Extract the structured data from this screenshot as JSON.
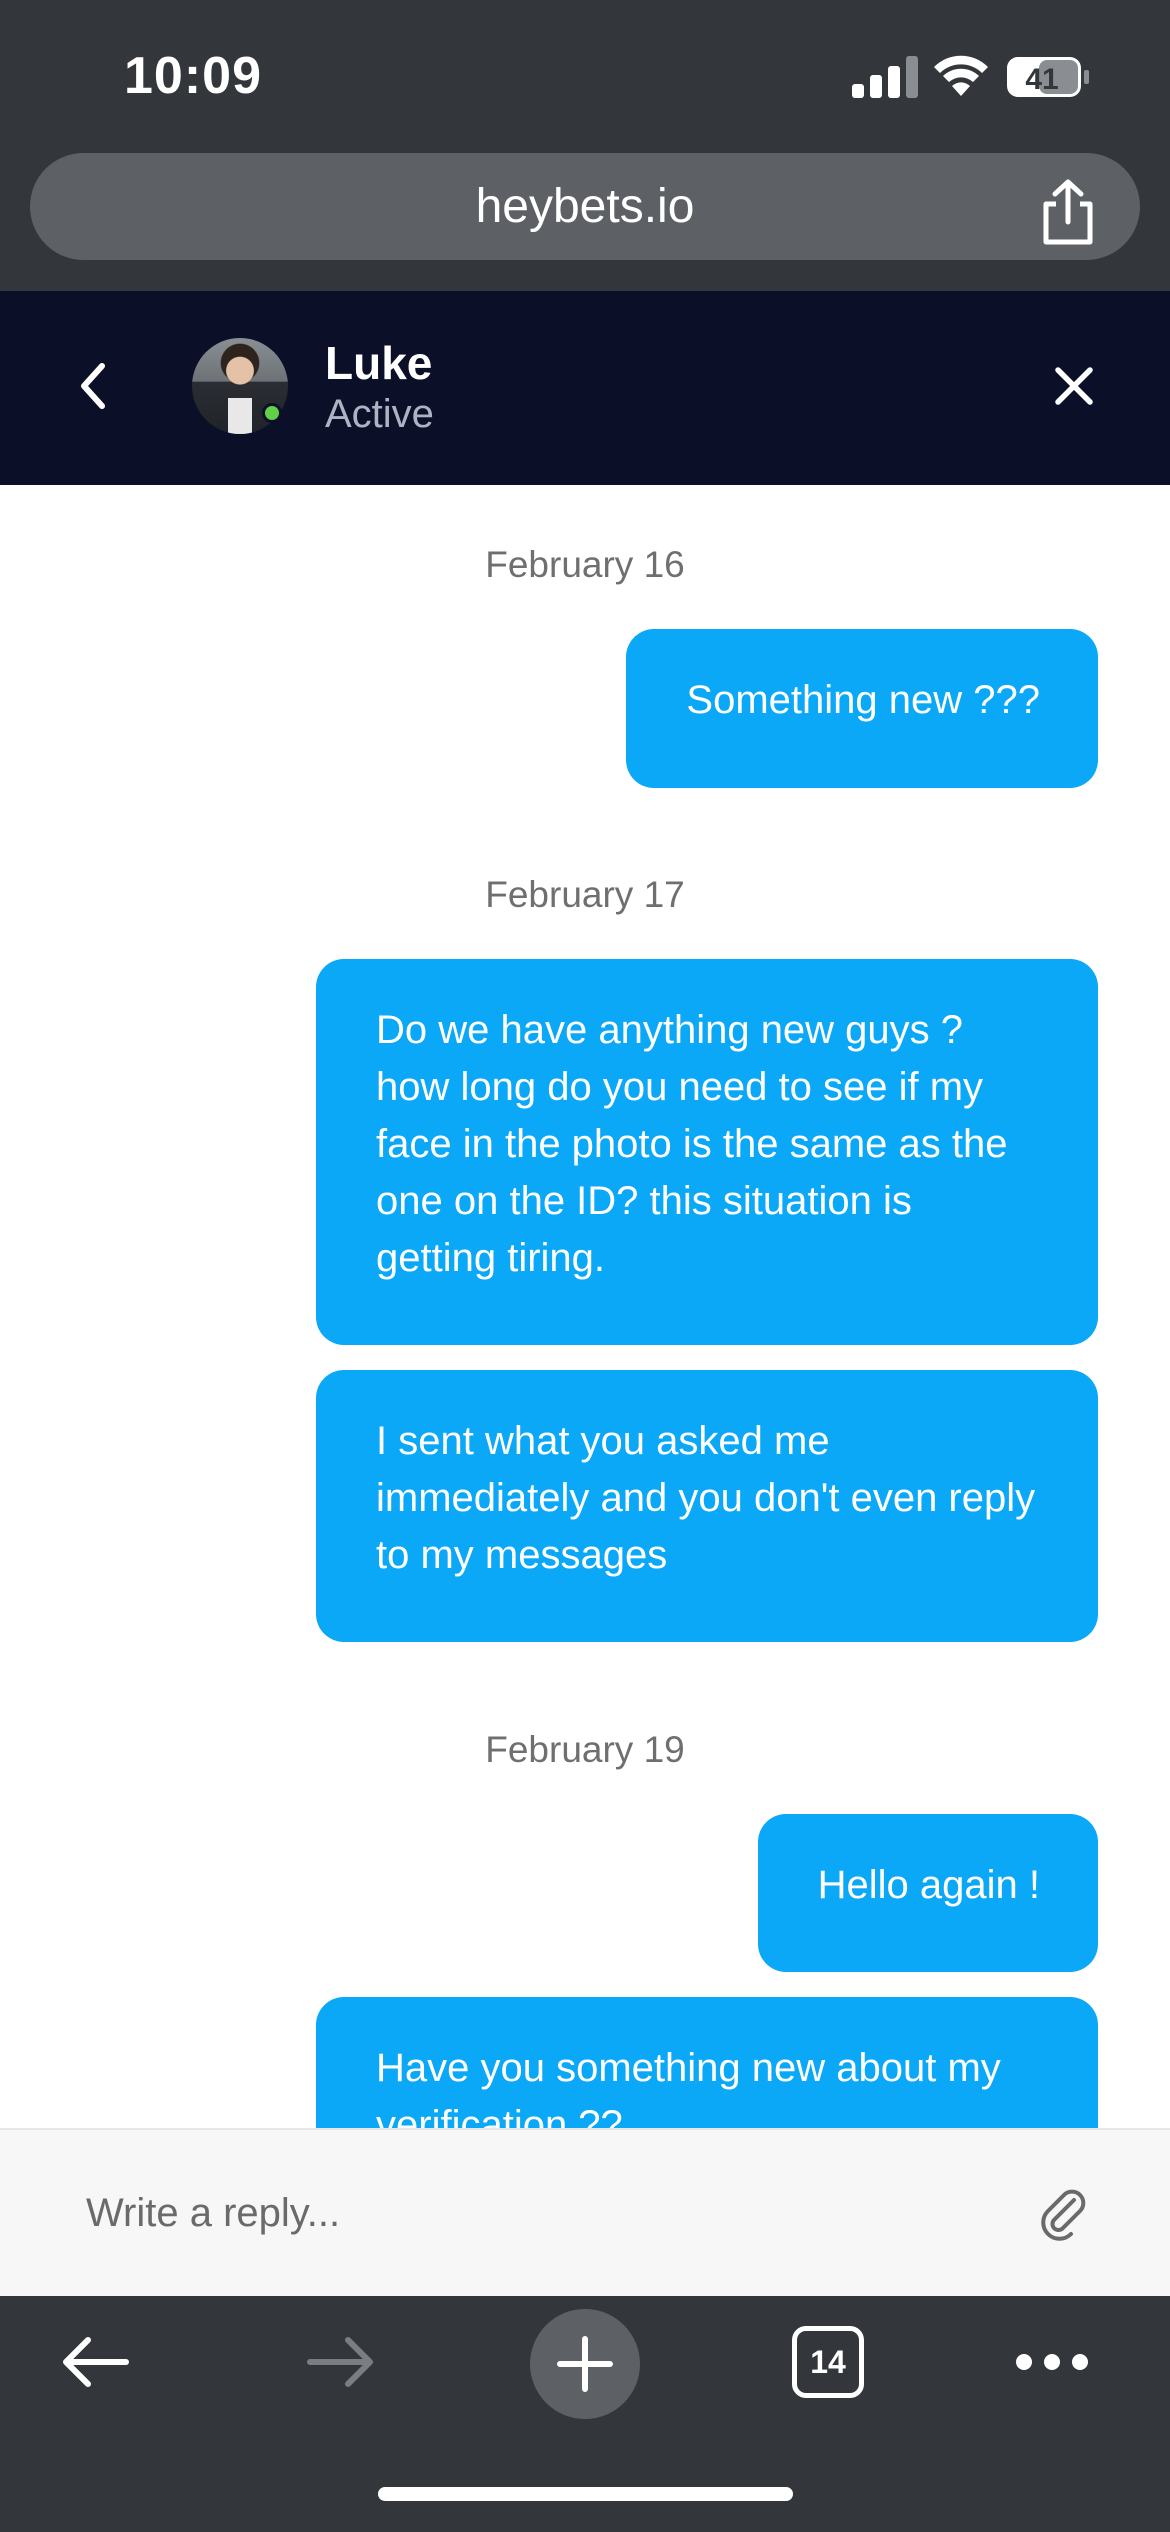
{
  "status_bar": {
    "time": "10:09",
    "battery": "41"
  },
  "browser": {
    "url": "heybets.io",
    "tab_count": "14"
  },
  "chat_header": {
    "name": "Luke",
    "status": "Active"
  },
  "messages": [
    {
      "date": "February 16"
    },
    {
      "text": "Something new ???"
    },
    {
      "date": "February 17"
    },
    {
      "text": "Do we have anything new guys ? how long do you need to see if my face in the photo is the same as the one on the ID? this situation is getting tiring."
    },
    {
      "text": "I sent what you asked me immediately and you don't even reply to my messages"
    },
    {
      "date": "February 19"
    },
    {
      "text": "Hello again !"
    },
    {
      "text": "Have you something new about my verification ??"
    }
  ],
  "reply": {
    "placeholder": "Write a reply..."
  },
  "colors": {
    "bubble": "#0ba8f8",
    "header_bg": "#0b1028",
    "online": "#63d04a",
    "browser_chrome": "#33373b"
  },
  "icons": [
    "signal-icon",
    "wifi-icon",
    "battery-icon",
    "share-icon",
    "chevron-left-icon",
    "close-icon",
    "paperclip-icon",
    "arrow-left-icon",
    "arrow-right-icon",
    "plus-icon",
    "more-icon"
  ]
}
